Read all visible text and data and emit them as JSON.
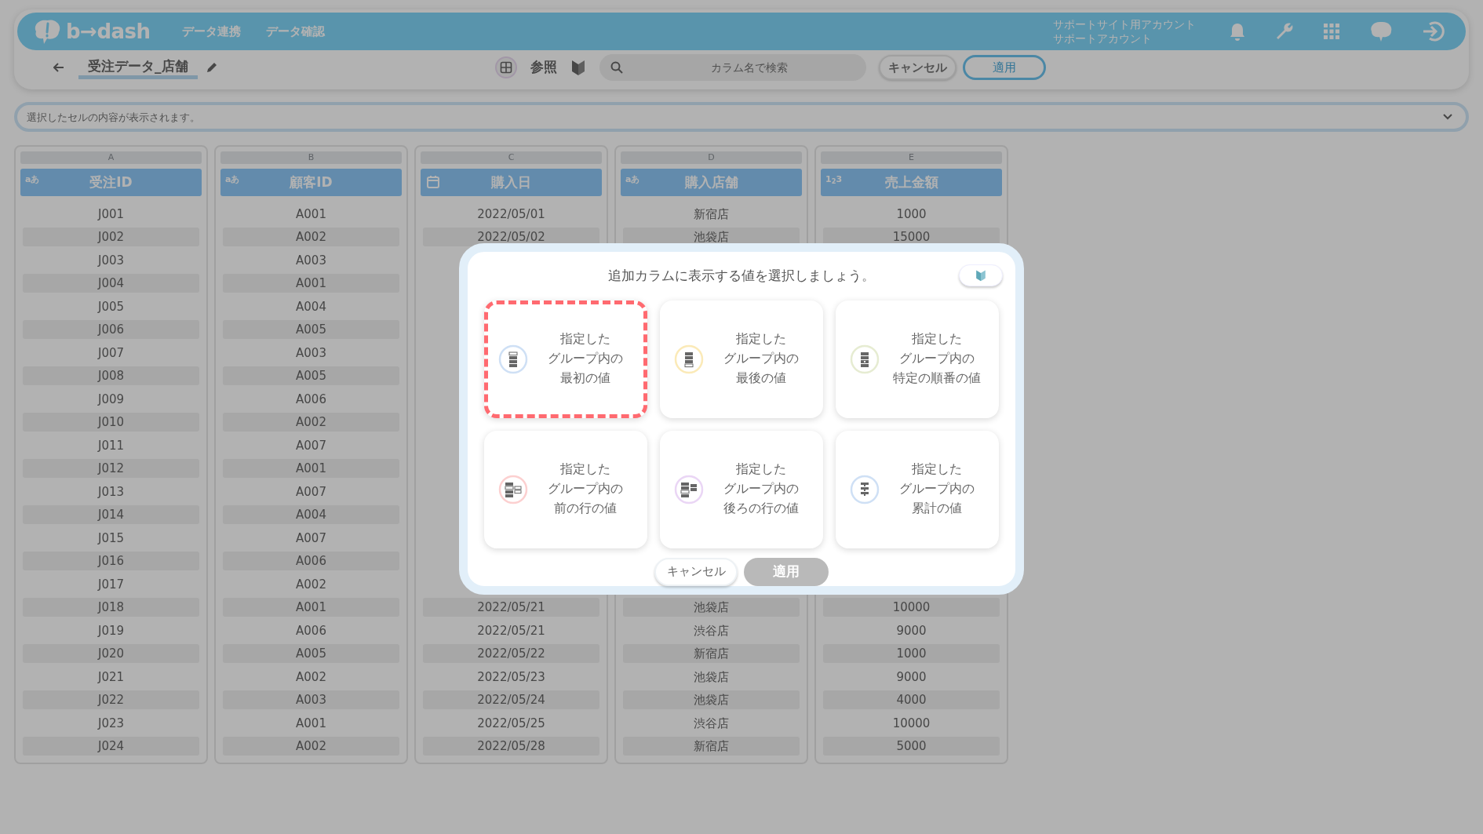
{
  "app_bar": {
    "logo": "b→dash",
    "nav": [
      {
        "label": "データ連携"
      },
      {
        "label": "データ確認"
      }
    ],
    "account": {
      "line_1": "サポートサイト用アカウント",
      "line_2": "サポートアカウント"
    }
  },
  "toolbar": {
    "title": "受注データ_店舗",
    "reference_label": "参照",
    "search": {
      "placeholder": "カラム名で検索"
    },
    "buttons": [
      {
        "label": "キャンセル",
        "kind": "secondary"
      },
      {
        "label": "適用",
        "kind": "primary"
      }
    ]
  },
  "cell_viewer": {
    "placeholder": "選択したセルの内容が表示されます。"
  },
  "table": {
    "columns": [
      {
        "letter": "A",
        "name": "受注ID",
        "kind": "text",
        "type_label": "aあ"
      },
      {
        "letter": "B",
        "name": "顧客ID",
        "kind": "text",
        "type_label": "aあ"
      },
      {
        "letter": "C",
        "name": "購入日",
        "kind": "date"
      },
      {
        "letter": "D",
        "name": "購入店舗",
        "kind": "text",
        "type_label": "aあ"
      },
      {
        "letter": "E",
        "name": "売上金額",
        "kind": "number",
        "type_label": "1$_{2}$3"
      }
    ],
    "rows": [
      [
        "J001",
        "A001",
        "2022/05/01",
        "新宿店",
        "1000"
      ],
      [
        "J002",
        "A002",
        "2022/05/02",
        "池袋店",
        "15000"
      ],
      [
        "J003",
        "A003"
      ],
      [
        "J004",
        "A001"
      ],
      [
        "J005",
        "A004"
      ],
      [
        "J006",
        "A005"
      ],
      [
        "J007",
        "A003"
      ],
      [
        "J008",
        "A005"
      ],
      [
        "J009",
        "A006"
      ],
      [
        "J010",
        "A002"
      ],
      [
        "J011",
        "A007"
      ],
      [
        "J012",
        "A001"
      ],
      [
        "J013",
        "A007"
      ],
      [
        "J014",
        "A004"
      ],
      [
        "J015",
        "A007"
      ],
      [
        "J016",
        "A006"
      ],
      [
        "J017",
        "A002"
      ],
      [
        "J018",
        "A001",
        "2022/05/21",
        "池袋店",
        "10000"
      ],
      [
        "J019",
        "A006",
        "2022/05/21",
        "渋谷店",
        "9000"
      ],
      [
        "J020",
        "A005",
        "2022/05/22",
        "新宿店",
        "1000"
      ],
      [
        "J021",
        "A002",
        "2022/05/23",
        "池袋店",
        "9000"
      ],
      [
        "J022",
        "A003",
        "2022/05/24",
        "池袋店",
        "4000"
      ],
      [
        "J023",
        "A001",
        "2022/05/25",
        "渋谷店",
        "10000"
      ],
      [
        "J024",
        "A002",
        "2022/05/28",
        "新宿店",
        "5000"
      ]
    ]
  },
  "dialog": {
    "title": "追加カラムに表示する値を選択しましょう。",
    "options": [
      {
        "kind": "first",
        "lines": [
          "指定した",
          "グループ内の",
          "最初の値"
        ],
        "selected": true
      },
      {
        "kind": "last",
        "lines": [
          "指定した",
          "グループ内の",
          "最後の値"
        ],
        "selected": false
      },
      {
        "kind": "nth",
        "lines": [
          "指定した",
          "グループ内の",
          "特定の順番の値"
        ],
        "selected": false
      },
      {
        "kind": "previous",
        "lines": [
          "指定した",
          "グループ内の",
          "前の行の値"
        ],
        "selected": false
      },
      {
        "kind": "next",
        "lines": [
          "指定した",
          "グループ内の",
          "後ろの行の値"
        ],
        "selected": false
      },
      {
        "kind": "cumulative",
        "lines": [
          "指定した",
          "グループ内の",
          "累計の値"
        ],
        "selected": false
      }
    ],
    "buttons": [
      {
        "label": "キャンセル",
        "disabled": false
      },
      {
        "label": "適用",
        "disabled": true
      }
    ]
  }
}
